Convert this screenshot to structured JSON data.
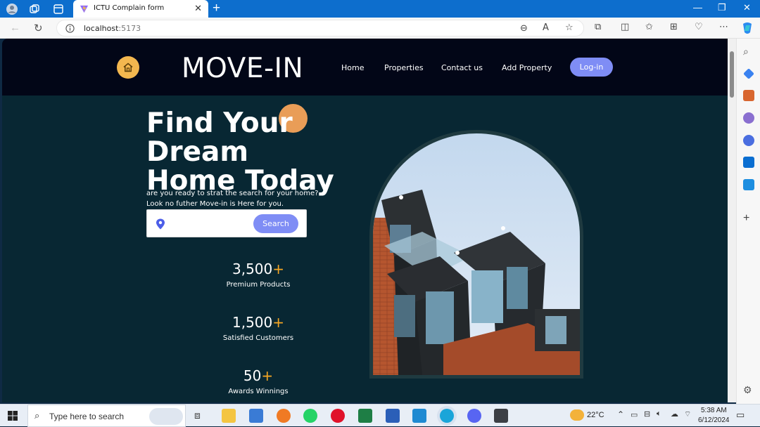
{
  "browser": {
    "tab_title": "ICTU Complain form",
    "url_host": "localhost",
    "url_port": ":5173"
  },
  "site": {
    "brand": "MOVE-IN",
    "nav": [
      "Home",
      "Properties",
      "Contact us",
      "Add Property"
    ],
    "login_label": "Log-in",
    "hero_title_line1": "Find Your Dream",
    "hero_title_line2": "Home Today",
    "hero_sub_line1": "are you ready to strat the search for your home?",
    "hero_sub_line2": "Look no futher Move-in is Here for you.",
    "search_label": "Search",
    "stats": [
      {
        "number": "3,500",
        "plus": "+",
        "label": "Premium Products"
      },
      {
        "number": "1,500",
        "plus": "+",
        "label": "Satisfied Customers"
      },
      {
        "number": "50",
        "plus": "+",
        "label": "Awards Winnings"
      }
    ]
  },
  "taskbar": {
    "search_placeholder": "Type here to search",
    "temperature": "22°C",
    "time": "5:38 AM",
    "date": "6/12/2024"
  },
  "colors": {
    "page_bg": "#082733",
    "nav_bg": "#020617",
    "accent_button": "#7f8df5",
    "accent_orange": "#f5a623",
    "home_badge": "#f3b74f"
  }
}
